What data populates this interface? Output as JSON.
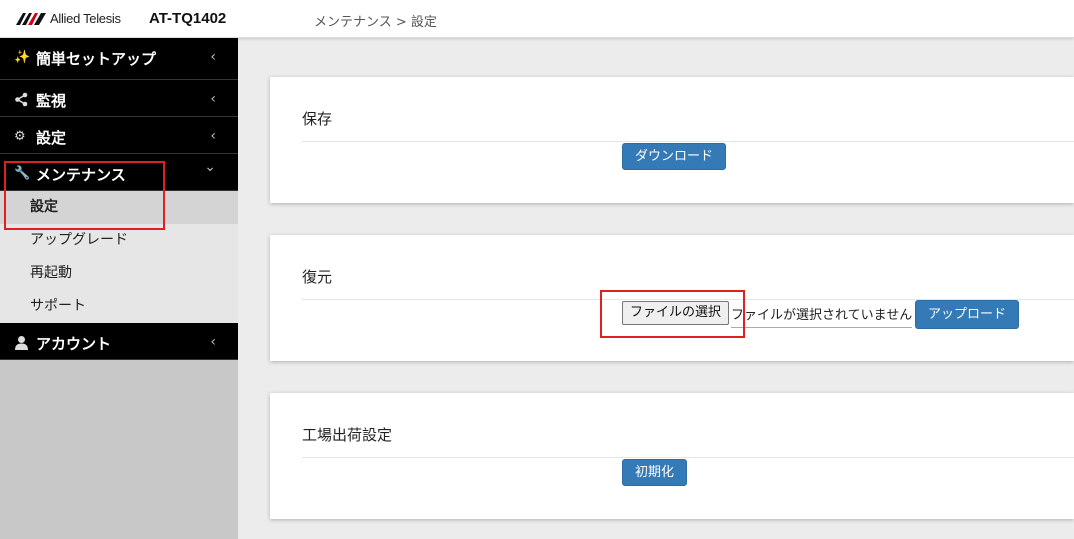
{
  "header": {
    "brand": "Allied Telesis",
    "model": "AT-TQ1402",
    "breadcrumb": "メンテナンス > 設定"
  },
  "sidebar": {
    "items": [
      {
        "label": "簡単セットアップ",
        "icon": "magic-wand-icon",
        "chevron": "‹"
      },
      {
        "label": "監視",
        "icon": "share-icon",
        "chevron": "‹"
      },
      {
        "label": "設定",
        "icon": "gear-icon",
        "chevron": "‹"
      },
      {
        "label": "メンテナンス",
        "icon": "wrench-icon",
        "chevron": "⌄",
        "expanded": true,
        "children": [
          {
            "label": "設定",
            "active": true
          },
          {
            "label": "アップグレード"
          },
          {
            "label": "再起動"
          },
          {
            "label": "サポート"
          }
        ]
      },
      {
        "label": "アカウント",
        "icon": "user-icon",
        "chevron": "‹"
      }
    ]
  },
  "main": {
    "save": {
      "title": "保存",
      "button": "ダウンロード"
    },
    "restore": {
      "title": "復元",
      "file_button": "ファイルの選択",
      "file_status": "ファイルが選択されていません",
      "upload_button": "アップロード"
    },
    "factory": {
      "title": "工場出荷設定",
      "button": "初期化"
    }
  },
  "colors": {
    "primary": "#337ab7",
    "highlight": "#e02020",
    "sidebar_dark": "#000000"
  }
}
